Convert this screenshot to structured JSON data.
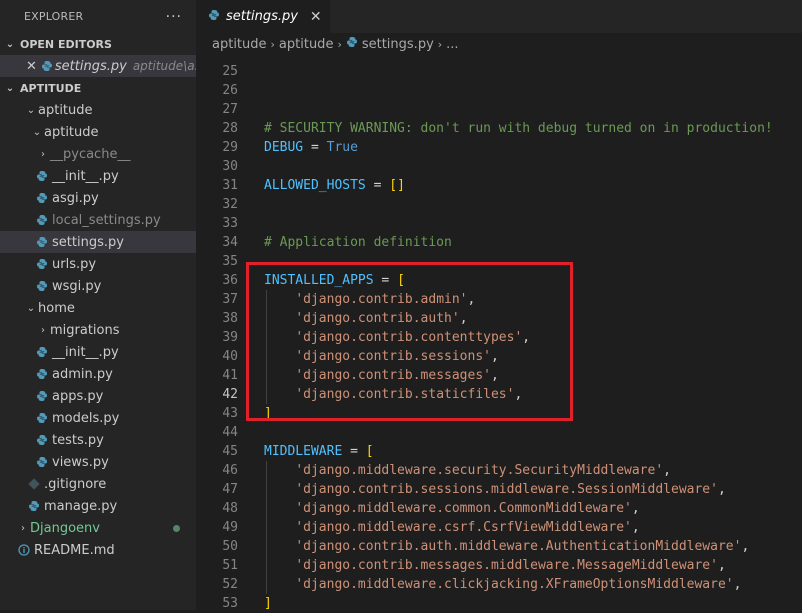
{
  "sidebar": {
    "title": "EXPLORER",
    "more": "···",
    "open_editors_label": "OPEN EDITORS",
    "open_editor": {
      "close": "✕",
      "name": "settings.py",
      "extra": "aptitude\\a..."
    },
    "project_label": "APTITUDE",
    "tree": [
      {
        "label": "aptitude",
        "kind": "folder-open"
      },
      {
        "label": "aptitude",
        "kind": "folder-open"
      },
      {
        "label": "__pycache__",
        "kind": "folder-closed"
      },
      {
        "label": "__init__.py",
        "kind": "py"
      },
      {
        "label": "asgi.py",
        "kind": "py"
      },
      {
        "label": "local_settings.py",
        "kind": "py"
      },
      {
        "label": "settings.py",
        "kind": "py"
      },
      {
        "label": "urls.py",
        "kind": "py"
      },
      {
        "label": "wsgi.py",
        "kind": "py"
      },
      {
        "label": "home",
        "kind": "folder-open"
      },
      {
        "label": "migrations",
        "kind": "folder-closed"
      },
      {
        "label": "__init__.py",
        "kind": "py"
      },
      {
        "label": "admin.py",
        "kind": "py"
      },
      {
        "label": "apps.py",
        "kind": "py"
      },
      {
        "label": "models.py",
        "kind": "py"
      },
      {
        "label": "tests.py",
        "kind": "py"
      },
      {
        "label": "views.py",
        "kind": "py"
      },
      {
        "label": ".gitignore",
        "kind": "git"
      },
      {
        "label": "manage.py",
        "kind": "py"
      },
      {
        "label": "Djangoenv",
        "kind": "folder-closed"
      },
      {
        "label": "README.md",
        "kind": "info"
      }
    ]
  },
  "editor": {
    "tab_label": "settings.py",
    "tab_close": "✕",
    "breadcrumb": [
      "aptitude",
      "aptitude",
      "settings.py",
      "..."
    ],
    "lines": [
      {
        "n": "25",
        "text": ""
      },
      {
        "n": "26",
        "text": ""
      },
      {
        "n": "27",
        "text": ""
      },
      {
        "n": "28",
        "text": "# SECURITY WARNING: don't run with debug turned on in production!"
      },
      {
        "n": "29",
        "text": "DEBUG = True"
      },
      {
        "n": "30",
        "text": ""
      },
      {
        "n": "31",
        "text": "ALLOWED_HOSTS = []"
      },
      {
        "n": "32",
        "text": ""
      },
      {
        "n": "33",
        "text": ""
      },
      {
        "n": "34",
        "text": "# Application definition"
      },
      {
        "n": "35",
        "text": ""
      },
      {
        "n": "36",
        "text": "INSTALLED_APPS = ["
      },
      {
        "n": "37",
        "text": "    'django.contrib.admin',"
      },
      {
        "n": "38",
        "text": "    'django.contrib.auth',"
      },
      {
        "n": "39",
        "text": "    'django.contrib.contenttypes',"
      },
      {
        "n": "40",
        "text": "    'django.contrib.sessions',"
      },
      {
        "n": "41",
        "text": "    'django.contrib.messages',"
      },
      {
        "n": "42",
        "text": "    'django.contrib.staticfiles',"
      },
      {
        "n": "43",
        "text": "]"
      },
      {
        "n": "44",
        "text": ""
      },
      {
        "n": "45",
        "text": "MIDDLEWARE = ["
      },
      {
        "n": "46",
        "text": "    'django.middleware.security.SecurityMiddleware',"
      },
      {
        "n": "47",
        "text": "    'django.contrib.sessions.middleware.SessionMiddleware',"
      },
      {
        "n": "48",
        "text": "    'django.middleware.common.CommonMiddleware',"
      },
      {
        "n": "49",
        "text": "    'django.middleware.csrf.CsrfViewMiddleware',"
      },
      {
        "n": "50",
        "text": "    'django.contrib.auth.middleware.AuthenticationMiddleware',"
      },
      {
        "n": "51",
        "text": "    'django.contrib.messages.middleware.MessageMiddleware',"
      },
      {
        "n": "52",
        "text": "    'django.middleware.clickjacking.XFrameOptionsMiddleware',"
      },
      {
        "n": "53",
        "text": "]"
      }
    ],
    "active_line": "42"
  },
  "colors": {
    "highlight_box": "#e0202a",
    "comment": "#6a9955",
    "string": "#ce9178",
    "keyword": "#569cd6",
    "bracket": "#ffd700"
  }
}
